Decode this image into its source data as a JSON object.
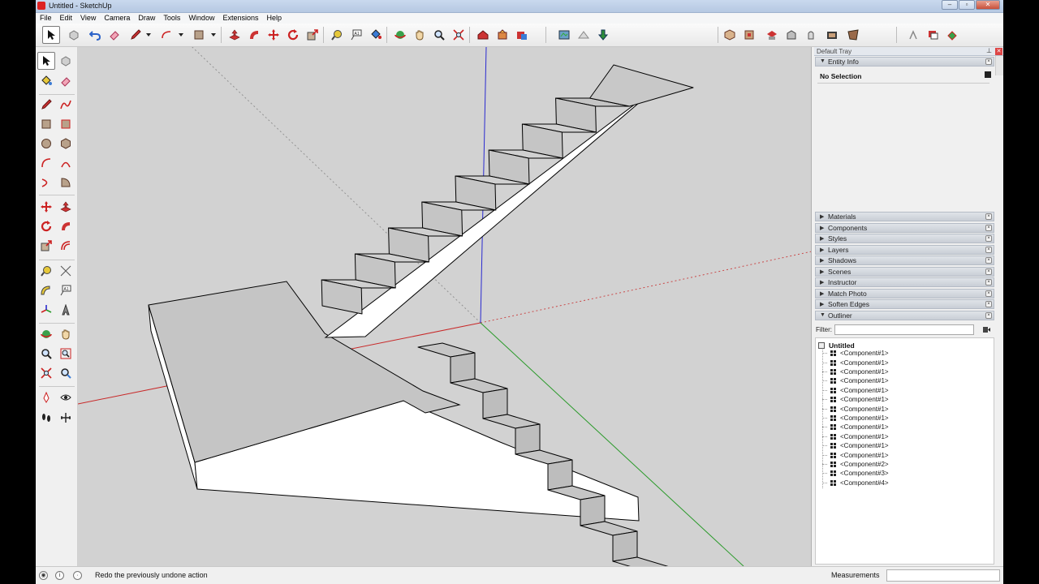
{
  "window": {
    "title": "Untitled - SketchUp"
  },
  "menu": [
    "File",
    "Edit",
    "View",
    "Camera",
    "Draw",
    "Tools",
    "Window",
    "Extensions",
    "Help"
  ],
  "tray": {
    "title": "Default Tray",
    "entity_info": {
      "title": "Entity Info",
      "status": "No Selection"
    },
    "panels": [
      "Materials",
      "Components",
      "Styles",
      "Layers",
      "Shadows",
      "Scenes",
      "Instructor",
      "Match Photo",
      "Soften Edges",
      "Outliner"
    ],
    "filter_label": "Filter:",
    "filter_value": ""
  },
  "outliner": {
    "root": "Untitled",
    "items": [
      "<Component#1>",
      "<Component#1>",
      "<Component#1>",
      "<Component#1>",
      "<Component#1>",
      "<Component#1>",
      "<Component#1>",
      "<Component#1>",
      "<Component#1>",
      "<Component#1>",
      "<Component#1>",
      "<Component#1>",
      "<Component#2>",
      "<Component#3>",
      "<Component#4>"
    ]
  },
  "status": {
    "text": "Redo the previously undone action",
    "measurements_label": "Measurements",
    "measurements_value": ""
  },
  "colors": {
    "viewport_bg": "#d2d2d2",
    "axis_red": "#c82828",
    "axis_green": "#2a9a2a",
    "axis_blue": "#2a2ad0",
    "face_top": "#c5c5c5",
    "face_riser": "#e8e8e8",
    "face_side": "#ffffff"
  }
}
